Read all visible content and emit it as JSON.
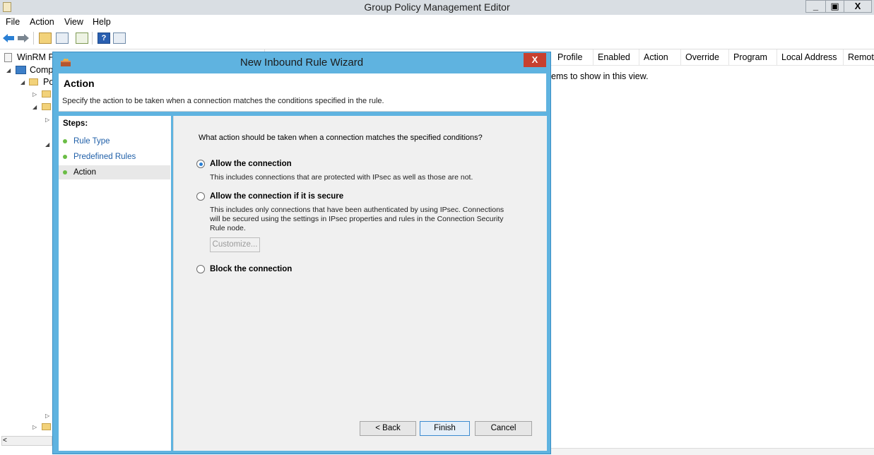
{
  "app": {
    "title": "Group Policy Management Editor",
    "window_controls": [
      "_",
      "▣",
      "X"
    ]
  },
  "menu": [
    "File",
    "Action",
    "View",
    "Help"
  ],
  "toolbar": {
    "icons": [
      "back-icon",
      "forward-icon",
      "up-folder-icon",
      "show-hide-tree-icon",
      "export-list-icon",
      "help-icon",
      "properties-icon"
    ]
  },
  "tree": {
    "items": [
      {
        "label": "WinRM Po",
        "expander": ""
      },
      {
        "label": "Comp",
        "expander": "◢"
      },
      {
        "label": "Po",
        "expander": "◢"
      }
    ],
    "expanders": [
      "▷",
      "◢",
      "▷",
      "◢",
      "▷",
      "▷"
    ]
  },
  "list": {
    "columns": [
      "Profile",
      "Enabled",
      "Action",
      "Override",
      "Program",
      "Local Address",
      "Remote"
    ],
    "empty_message": "ems to show in this view."
  },
  "dialog": {
    "title": "New Inbound Rule Wizard",
    "close_label": "X",
    "header_title": "Action",
    "header_subtitle": "Specify the action to be taken when a connection matches the conditions specified in the rule.",
    "steps_label": "Steps:",
    "steps": [
      {
        "label": "Rule Type",
        "state": "link"
      },
      {
        "label": "Predefined Rules",
        "state": "link"
      },
      {
        "label": "Action",
        "state": "current"
      }
    ],
    "question": "What action should be taken when a connection matches the specified conditions?",
    "options": [
      {
        "label": "Allow the connection",
        "checked": true,
        "description": [
          "This includes connections that are protected with IPsec as well as those are not."
        ]
      },
      {
        "label": "Allow the connection if it is secure",
        "checked": false,
        "description": [
          "This includes only connections that have been authenticated by using IPsec.  Connections",
          "will be secured using the settings in IPsec properties and rules in the Connection Security",
          "Rule node."
        ]
      },
      {
        "label": "Block the connection",
        "checked": false,
        "description": []
      }
    ],
    "customize_label": "Customize...",
    "buttons": {
      "back": "< Back",
      "finish": "Finish",
      "cancel": "Cancel"
    }
  },
  "colors": {
    "dialog_frame": "#5fb3e0",
    "close_button": "#c7402f",
    "step_dot": "#6bbd45",
    "link": "#1f5fa8"
  }
}
